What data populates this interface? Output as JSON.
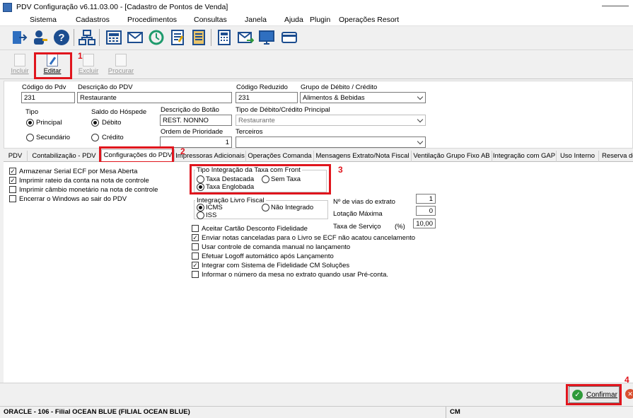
{
  "window": {
    "title": "PDV Configuração v6.11.03.00 - [Cadastro de Pontos de Venda]"
  },
  "menu": [
    "Sistema",
    "Cadastros",
    "Procedimentos",
    "Consultas",
    "Janela",
    "Ajuda",
    "Plugin",
    "Operações Resort"
  ],
  "toolbar_icons": [
    "exit-icon",
    "user-key-icon",
    "help-icon",
    "network-icon",
    "cash-register-icon",
    "mail-icon",
    "history-icon",
    "checklist-icon",
    "document-edit-icon",
    "calculator-icon",
    "mail-forward-icon",
    "monitor-icon",
    "card-icon"
  ],
  "actions": {
    "incluir": "Incluir",
    "editar": "Editar",
    "excluir": "Excluir",
    "procurar": "Procurar"
  },
  "annotations": {
    "n1": "1",
    "n2": "2",
    "n3": "3",
    "n4": "4"
  },
  "form": {
    "codigo_pdv": {
      "label": "Código do Pdv",
      "value": "231"
    },
    "descricao_pdv": {
      "label": "Descrição do PDV",
      "value": "Restaurante"
    },
    "codigo_reduzido": {
      "label": "Código Reduzido",
      "value": "231"
    },
    "grupo_debito": {
      "label": "Grupo de Débito / Crédito",
      "value": "Alimentos & Bebidas"
    },
    "tipo": {
      "label": "Tipo",
      "opt1": "Principal",
      "opt2": "Secundário"
    },
    "saldo": {
      "label": "Saldo do Hóspede",
      "opt1": "Débito",
      "opt2": "Crédito"
    },
    "descricao_botao": {
      "label": "Descrição do Botão",
      "value": "REST. NONNO"
    },
    "tipo_debito": {
      "label": "Tipo de Débito/Crédito Principal",
      "value": "Restaurante"
    },
    "ordem": {
      "label": "Ordem de Prioridade",
      "value": "1"
    },
    "terceiros": {
      "label": "Terceiros",
      "value": ""
    }
  },
  "tabs": [
    "PDV",
    "Contabilização - PDV",
    "Configurações do PDV",
    "Impressoras Adicionais",
    "Operações Comanda",
    "Mensagens Extrato/Nota Fiscal",
    "Ventilação Grupo Fixo AB",
    "Integração com GAP",
    "Uso Interno",
    "Reserva de"
  ],
  "config": {
    "left_checks": [
      {
        "label": "Armazenar Serial ECF por Mesa Aberta",
        "checked": true
      },
      {
        "label": "Imprimir rateio da conta na nota de controle",
        "checked": true
      },
      {
        "label": "Imprimir câmbio monetário na nota de controle",
        "checked": false
      },
      {
        "label": "Encerrar o Windows ao sair do PDV",
        "checked": false
      }
    ],
    "taxa_group": {
      "title": "Tipo Integração da Taxa com Front",
      "destacada": "Taxa Destacada",
      "sem_taxa": "Sem Taxa",
      "englobada": "Taxa Englobada"
    },
    "livro_group": {
      "title": "Integração Livro Fiscal",
      "icms": "ICMS",
      "iss": "ISS",
      "nao_integrado": "Não Integrado"
    },
    "vias": {
      "label": "Nº de vias do extrato",
      "value": "1"
    },
    "lotacao": {
      "label": "Lotação Máxima",
      "value": "0"
    },
    "taxa_servico": {
      "label": "Taxa de Serviço",
      "unit": "(%)",
      "value": "10,00"
    },
    "bottom_checks": [
      {
        "label": "Aceitar Cartão Desconto Fidelidade",
        "checked": false
      },
      {
        "label": "Enviar notas canceladas para o Livro se ECF não acatou cancelamento",
        "checked": true
      },
      {
        "label": "Usar controle de comanda manual no lançamento",
        "checked": false
      },
      {
        "label": "Efetuar Logoff automático após Lançamento",
        "checked": false
      },
      {
        "label": "Integrar com Sistema de Fidelidade CM Soluções",
        "checked": true
      },
      {
        "label": "Informar o número da mesa no extrato quando usar Pré-conta.",
        "checked": false
      }
    ]
  },
  "buttons": {
    "confirmar": "Confirmar"
  },
  "status": {
    "left": "ORACLE - 106 - Filial OCEAN BLUE (FILIAL OCEAN BLUE)",
    "right": "CM"
  },
  "colors": {
    "highlight": "#e0151d",
    "ok_green": "#2e9a3a"
  }
}
